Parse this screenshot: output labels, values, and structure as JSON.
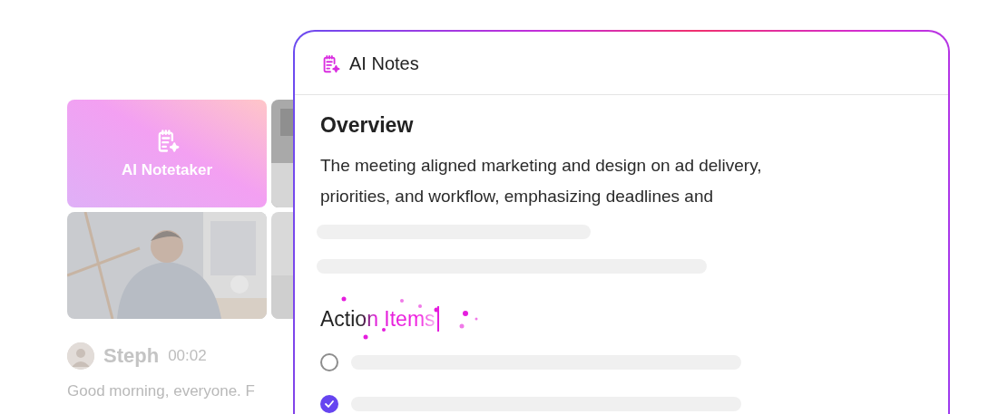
{
  "meeting": {
    "tiles": [
      {
        "kind": "notetaker",
        "label": "AI Notetaker"
      },
      {
        "kind": "picture"
      },
      {
        "kind": "picture"
      },
      {
        "kind": "picture"
      }
    ],
    "transcript": {
      "speaker": "Steph",
      "time": "00:02",
      "text": "Good morning, everyone. F"
    }
  },
  "notes": {
    "title": "AI Notes",
    "overview": {
      "heading": "Overview",
      "lines": [
        "The meeting aligned marketing and design on ad delivery,",
        "priorities, and workflow, emphasizing deadlines and"
      ]
    },
    "action_items": {
      "heading": "Action Items",
      "items": [
        {
          "checked": false
        },
        {
          "checked": true
        }
      ]
    }
  }
}
